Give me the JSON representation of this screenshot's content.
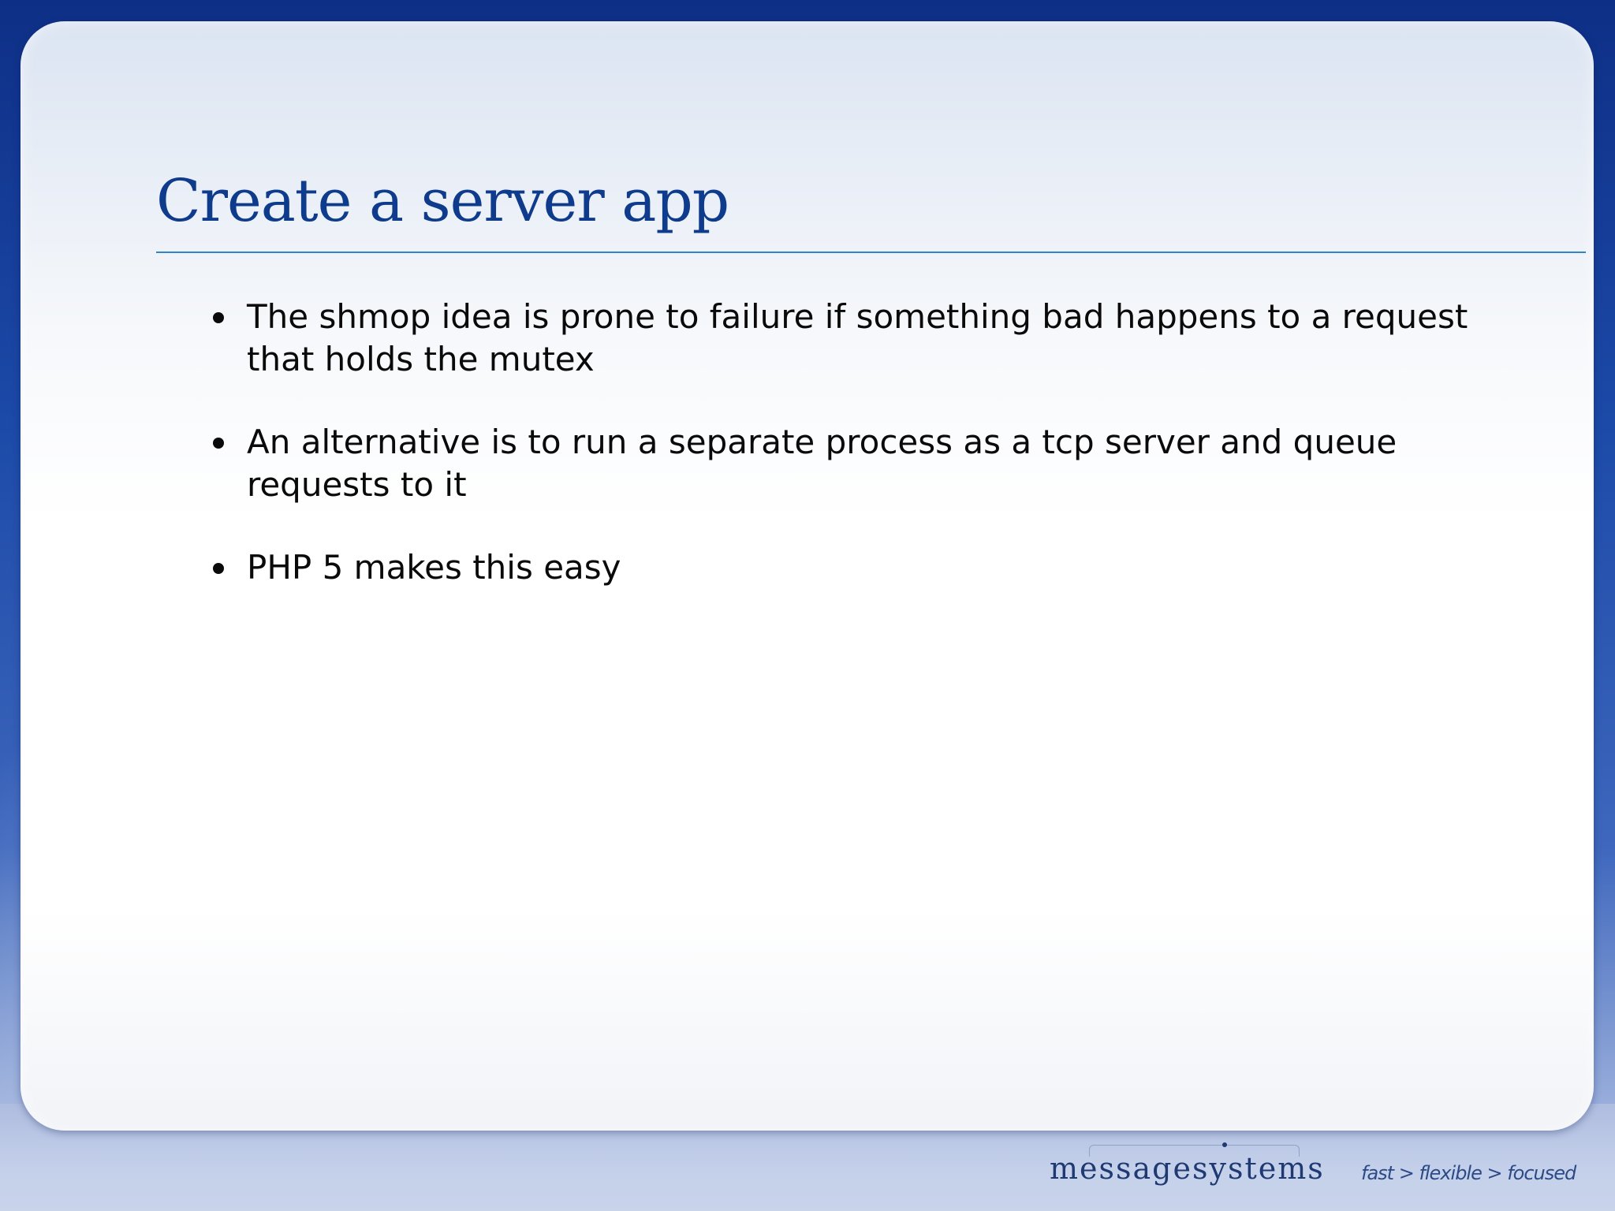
{
  "slide": {
    "title": "Create a server app",
    "bullets": [
      "The shmop idea is prone to failure if something bad happens to a request that holds the mutex",
      "An alternative is to run a separate process as a tcp server and queue requests to it",
      "PHP 5 makes this easy"
    ]
  },
  "footer": {
    "logo_text": "messagesystems",
    "tagline": "fast > flexible > focused"
  },
  "colors": {
    "title": "#0f3b8c",
    "rule": "#2f86c8",
    "frame": "#1c4aa8"
  }
}
